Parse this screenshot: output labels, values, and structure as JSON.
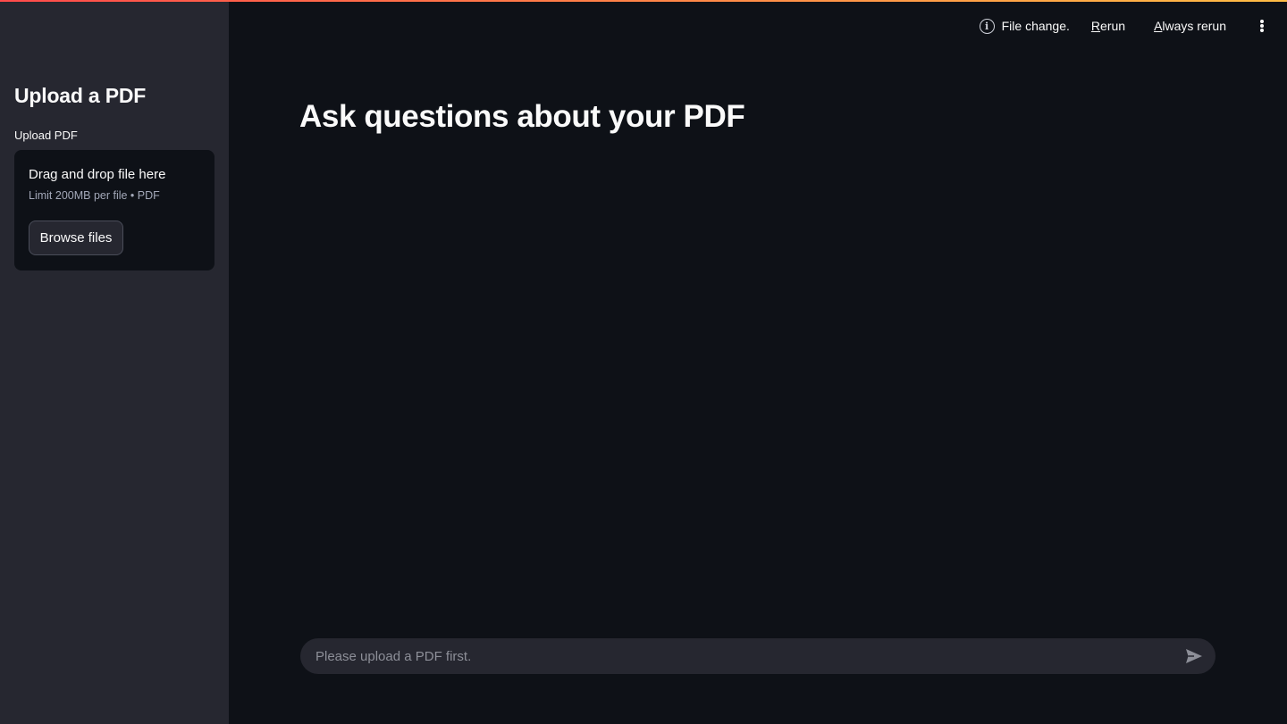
{
  "sidebar": {
    "title": "Upload a PDF",
    "uploader": {
      "label": "Upload PDF",
      "dropzone_title": "Drag and drop file here",
      "dropzone_limit": "Limit 200MB per file • PDF",
      "browse_label": "Browse files"
    }
  },
  "header": {
    "status_text": "File change.",
    "rerun_first": "R",
    "rerun_rest": "erun",
    "always_first": "A",
    "always_rest": "lways rerun",
    "menu_icon": "kebab-menu-icon"
  },
  "main": {
    "title": "Ask questions about your PDF"
  },
  "chat": {
    "placeholder": "Please upload a PDF first.",
    "send_icon": "send-icon"
  },
  "colors": {
    "background": "#0e1117",
    "sidebar": "#262730",
    "accent_start": "#ff4b4b",
    "accent_end": "#ffbd45"
  }
}
